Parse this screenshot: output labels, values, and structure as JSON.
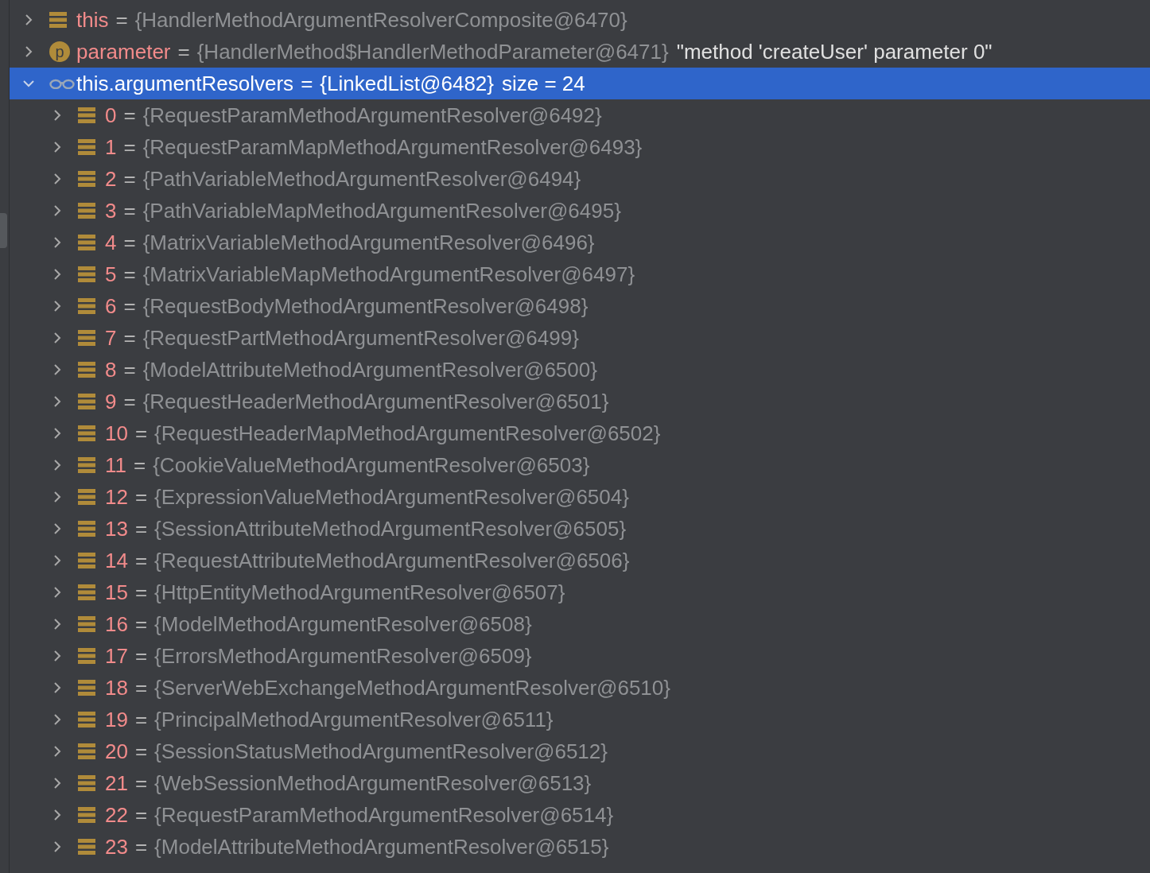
{
  "variables": [
    {
      "kind": "field",
      "name": "this",
      "sep": "=",
      "value": "{HandlerMethodArgumentResolverComposite@6470}",
      "expanded": false,
      "selected": false
    },
    {
      "kind": "parameter",
      "badge": "p",
      "name": "parameter",
      "sep": "=",
      "value": "{HandlerMethod$HandlerMethodParameter@6471}",
      "extra": "\"method 'createUser' parameter 0\"",
      "expanded": false,
      "selected": false
    },
    {
      "kind": "watch",
      "name": "this.argumentResolvers",
      "sep": "=",
      "value": "{LinkedList@6482}",
      "extra": "size = 24",
      "expanded": true,
      "selected": true,
      "children": [
        {
          "kind": "field",
          "name": "0",
          "sep": "=",
          "value": "{RequestParamMethodArgumentResolver@6492}",
          "expanded": false,
          "selected": false
        },
        {
          "kind": "field",
          "name": "1",
          "sep": "=",
          "value": "{RequestParamMapMethodArgumentResolver@6493}",
          "expanded": false,
          "selected": false
        },
        {
          "kind": "field",
          "name": "2",
          "sep": "=",
          "value": "{PathVariableMethodArgumentResolver@6494}",
          "expanded": false,
          "selected": false
        },
        {
          "kind": "field",
          "name": "3",
          "sep": "=",
          "value": "{PathVariableMapMethodArgumentResolver@6495}",
          "expanded": false,
          "selected": false
        },
        {
          "kind": "field",
          "name": "4",
          "sep": "=",
          "value": "{MatrixVariableMethodArgumentResolver@6496}",
          "expanded": false,
          "selected": false
        },
        {
          "kind": "field",
          "name": "5",
          "sep": "=",
          "value": "{MatrixVariableMapMethodArgumentResolver@6497}",
          "expanded": false,
          "selected": false
        },
        {
          "kind": "field",
          "name": "6",
          "sep": "=",
          "value": "{RequestBodyMethodArgumentResolver@6498}",
          "expanded": false,
          "selected": false
        },
        {
          "kind": "field",
          "name": "7",
          "sep": "=",
          "value": "{RequestPartMethodArgumentResolver@6499}",
          "expanded": false,
          "selected": false
        },
        {
          "kind": "field",
          "name": "8",
          "sep": "=",
          "value": "{ModelAttributeMethodArgumentResolver@6500}",
          "expanded": false,
          "selected": false
        },
        {
          "kind": "field",
          "name": "9",
          "sep": "=",
          "value": "{RequestHeaderMethodArgumentResolver@6501}",
          "expanded": false,
          "selected": false
        },
        {
          "kind": "field",
          "name": "10",
          "sep": "=",
          "value": "{RequestHeaderMapMethodArgumentResolver@6502}",
          "expanded": false,
          "selected": false
        },
        {
          "kind": "field",
          "name": "11",
          "sep": "=",
          "value": "{CookieValueMethodArgumentResolver@6503}",
          "expanded": false,
          "selected": false
        },
        {
          "kind": "field",
          "name": "12",
          "sep": "=",
          "value": "{ExpressionValueMethodArgumentResolver@6504}",
          "expanded": false,
          "selected": false
        },
        {
          "kind": "field",
          "name": "13",
          "sep": "=",
          "value": "{SessionAttributeMethodArgumentResolver@6505}",
          "expanded": false,
          "selected": false
        },
        {
          "kind": "field",
          "name": "14",
          "sep": "=",
          "value": "{RequestAttributeMethodArgumentResolver@6506}",
          "expanded": false,
          "selected": false
        },
        {
          "kind": "field",
          "name": "15",
          "sep": "=",
          "value": "{HttpEntityMethodArgumentResolver@6507}",
          "expanded": false,
          "selected": false
        },
        {
          "kind": "field",
          "name": "16",
          "sep": "=",
          "value": "{ModelMethodArgumentResolver@6508}",
          "expanded": false,
          "selected": false
        },
        {
          "kind": "field",
          "name": "17",
          "sep": "=",
          "value": "{ErrorsMethodArgumentResolver@6509}",
          "expanded": false,
          "selected": false
        },
        {
          "kind": "field",
          "name": "18",
          "sep": "=",
          "value": "{ServerWebExchangeMethodArgumentResolver@6510}",
          "expanded": false,
          "selected": false
        },
        {
          "kind": "field",
          "name": "19",
          "sep": "=",
          "value": "{PrincipalMethodArgumentResolver@6511}",
          "expanded": false,
          "selected": false
        },
        {
          "kind": "field",
          "name": "20",
          "sep": "=",
          "value": "{SessionStatusMethodArgumentResolver@6512}",
          "expanded": false,
          "selected": false
        },
        {
          "kind": "field",
          "name": "21",
          "sep": "=",
          "value": "{WebSessionMethodArgumentResolver@6513}",
          "expanded": false,
          "selected": false
        },
        {
          "kind": "field",
          "name": "22",
          "sep": "=",
          "value": "{RequestParamMethodArgumentResolver@6514}",
          "expanded": false,
          "selected": false
        },
        {
          "kind": "field",
          "name": "23",
          "sep": "=",
          "value": "{ModelAttributeMethodArgumentResolver@6515}",
          "expanded": false,
          "selected": false
        }
      ]
    }
  ]
}
